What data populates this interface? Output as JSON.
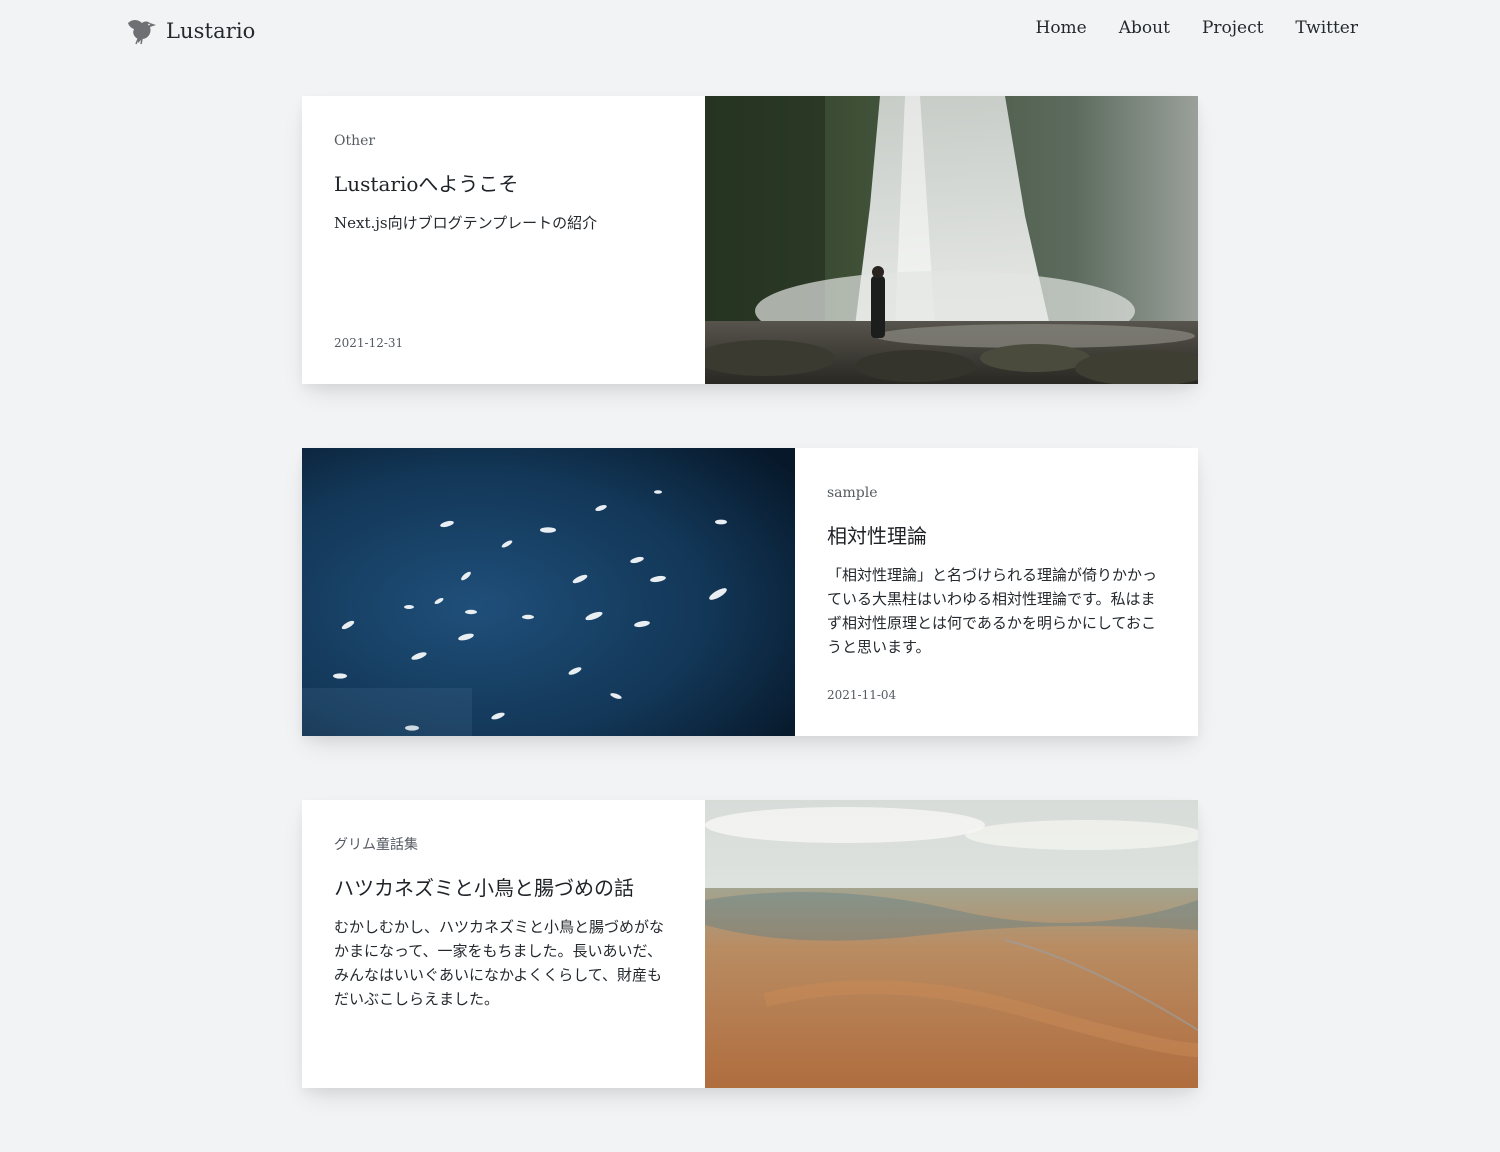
{
  "header": {
    "logo_text": "Lustario",
    "logo_icon": "bird-icon",
    "nav": [
      {
        "label": "Home"
      },
      {
        "label": "About"
      },
      {
        "label": "Project"
      },
      {
        "label": "Twitter"
      }
    ]
  },
  "posts": [
    {
      "category": "Other",
      "title": "Lustarioへようこそ",
      "excerpt": "Next.js向けブログテンプレートの紹介",
      "date": "2021-12-31",
      "image": "waterfall-photo"
    },
    {
      "category": "sample",
      "title": "相対性理論",
      "excerpt": "「相対性理論」と名づけられる理論が倚りかかっている大黒柱はいわゆる相対性理論です。私はまず相対性原理とは何であるかを明らかにしておこうと思います。",
      "date": "2021-11-04",
      "image": "boats-aerial-photo"
    },
    {
      "category": "グリム童話集",
      "title": "ハツカネズミと小鳥と腸づめの話",
      "excerpt": "むかしむかし、ハツカネズミと小鳥と腸づめがなかまになって、一家をもちました。長いあいだ、みんなはいいぐあいになかよくくらして、財産もだいぶこしらえました。",
      "date": "",
      "image": "desert-aerial-photo"
    }
  ],
  "colors": {
    "background": "#f2f3f5",
    "card": "#ffffff",
    "text": "#1f2328",
    "muted": "#555b62"
  }
}
